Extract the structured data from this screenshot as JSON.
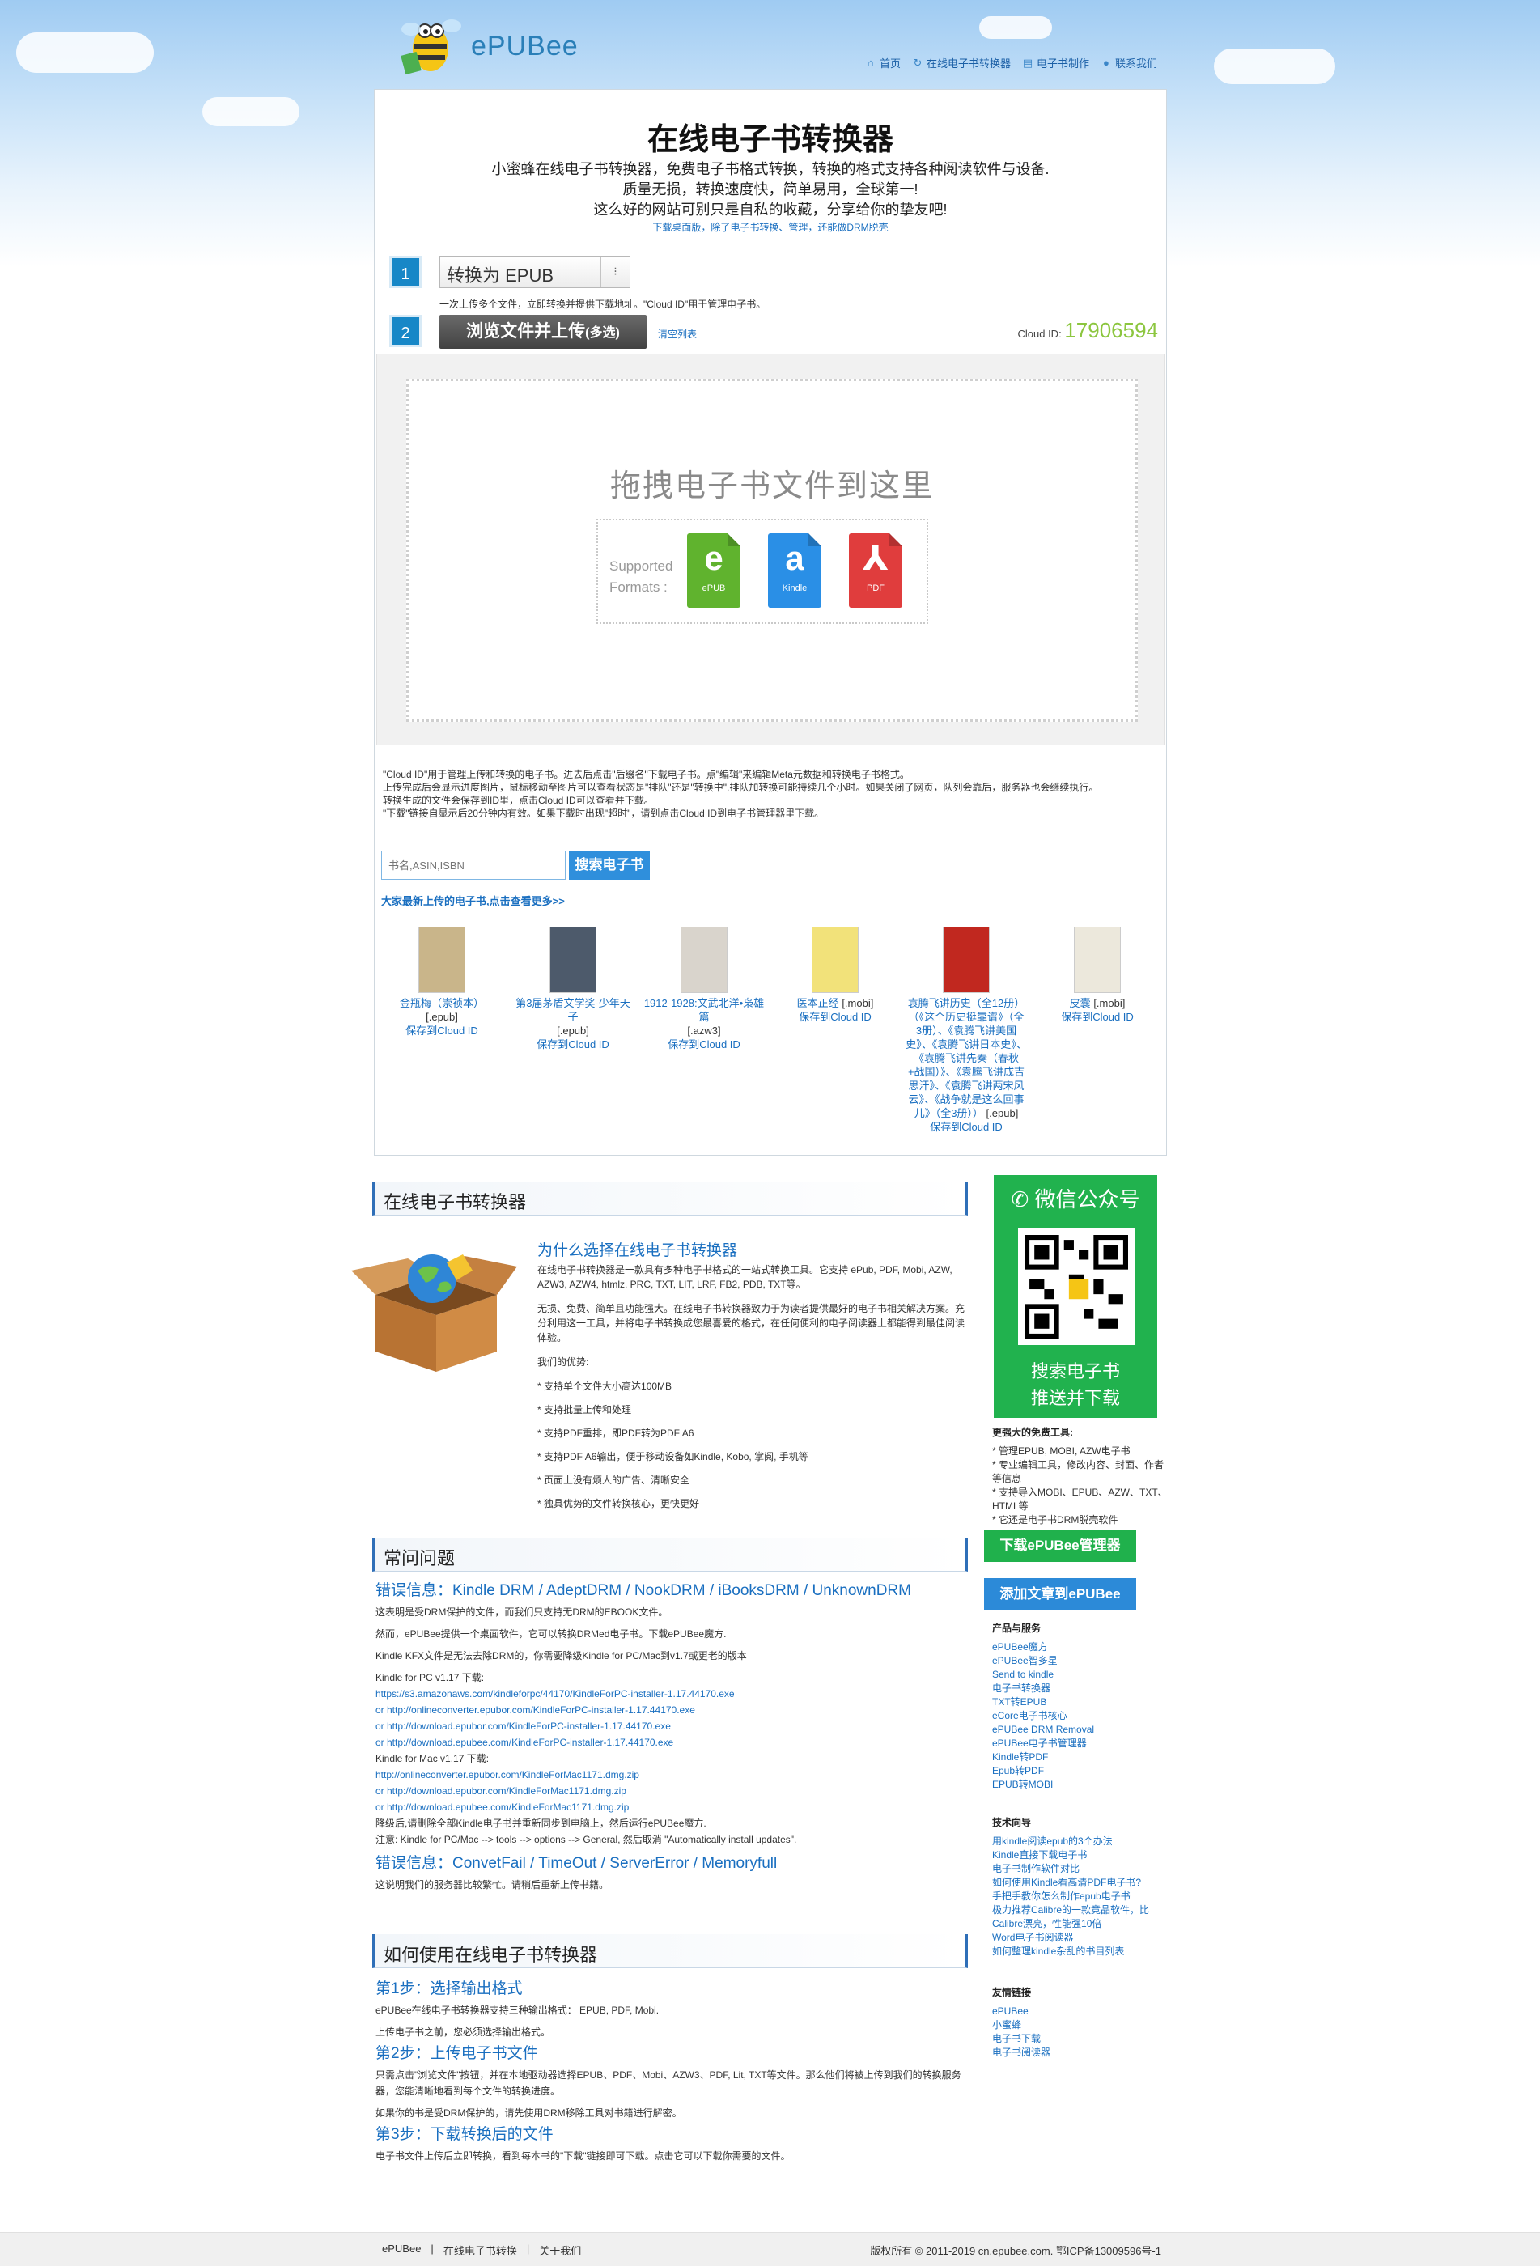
{
  "header": {
    "logo_text": "ePUBee",
    "nav": [
      {
        "icon": "home-icon",
        "label": "首页"
      },
      {
        "icon": "refresh-icon",
        "label": "在线电子书转换器"
      },
      {
        "icon": "book-icon",
        "label": "电子书制作"
      },
      {
        "icon": "user-icon",
        "label": "联系我们"
      }
    ]
  },
  "converter": {
    "title": "在线电子书转换器",
    "intro_lines": [
      "小蜜蜂在线电子书转换器，免费电子书格式转换，转换的格式支持各种阅读软件与设备.",
      "质量无损，转换速度快，简单易用，全球第一!",
      "这么好的网站可别只是自私的收藏，分享给你的挚友吧!"
    ],
    "desktop_link": "下载桌面版，除了电子书转换、管理，还能做DRM脱壳",
    "step1_number": "1",
    "step1_select": "转换为 EPUB",
    "step1_select_arrow": "⁝",
    "step1_note": "一次上传多个文件，立即转换并提供下载地址。\"Cloud ID\"用于管理电子书。",
    "step2_number": "2",
    "upload_button": "浏览文件并上传",
    "upload_button_suffix": "(多选)",
    "clear_list": "清空列表",
    "cloud_id_label": "Cloud ID:",
    "cloud_id_value": "17906594",
    "drop_text": "拖拽电子书文件到这里",
    "supported_label": [
      "Supported",
      "Formats :"
    ],
    "formats": [
      {
        "glyph": "e",
        "caption": "ePUB",
        "icon": "epub-icon"
      },
      {
        "glyph": "a",
        "caption": "Kindle",
        "icon": "kindle-icon"
      },
      {
        "glyph": "⅄",
        "caption": "PDF",
        "icon": "pdf-icon"
      }
    ],
    "notes": [
      "\"Cloud ID\"用于管理上传和转换的电子书。进去后点击\"后缀名\"下载电子书。点\"编辑\"来编辑Meta元数据和转换电子书格式。",
      "上传完成后会显示进度图片，鼠标移动至图片可以查看状态是\"排队\"还是\"转换中\",排队加转换可能持续几个小时。如果关闭了网页，队列会靠后，服务器也会继续执行。",
      "转换生成的文件会保存到ID里，点击Cloud ID可以查看并下载。",
      "\"下载\"链接自显示后20分钟内有效。如果下载时出现\"超时\"，请到点击Cloud ID到电子书管理器里下载。"
    ],
    "search_placeholder": "书名,ASIN,ISBN",
    "search_button": "搜索电子书",
    "latest_link": "大家最新上传的电子书,点击查看更多>>",
    "books": [
      {
        "title": "金瓶梅（崇祯本）",
        "ext": "[.epub]",
        "save": "保存到Cloud ID",
        "cover": "#c9b58a"
      },
      {
        "title": "第3届茅盾文学奖-少年天子",
        "ext": "[.epub]",
        "save": "保存到Cloud ID",
        "cover": "#4d5a6b"
      },
      {
        "title": "1912-1928:文武北洋•枭雄篇",
        "ext": "[.azw3]",
        "save": "保存到Cloud ID",
        "cover": "#d9d4cc"
      },
      {
        "title": "医本正经",
        "ext": "[.mobi]",
        "save": "保存到Cloud ID",
        "cover": "#f2e27a"
      },
      {
        "title": "袁腾飞讲历史（全12册）（《这个历史挺靠谱》（全3册）、《袁腾飞讲美国史》、《袁腾飞讲日本史》、《袁腾飞讲先秦（春秋+战国）》、《袁腾飞讲成吉思汗》、《袁腾飞讲两宋风云》、《战争就是这么回事儿》（全3册））",
        "ext": "[.epub]",
        "save": "保存到Cloud ID",
        "cover": "#c1281f"
      },
      {
        "title": "皮囊",
        "ext": "[.mobi]",
        "save": "保存到Cloud ID",
        "cover": "#ece8dc"
      }
    ]
  },
  "about": {
    "section_title": "在线电子书转换器",
    "why_title": "为什么选择在线电子书转换器",
    "paragraphs": [
      "在线电子书转换器是一款具有多种电子书格式的一站式转换工具。它支持 ePub, PDF, Mobi, AZW, AZW3, AZW4, htmlz, PRC, TXT, LIT, LRF, FB2, PDB, TXT等。",
      "无损、免费、简单且功能强大。在线电子书转换器致力于为读者提供最好的电子书相关解决方案。充分利用这一工具，并将电子书转换成您最喜爱的格式，在任何便利的电子阅读器上都能得到最佳阅读体验。",
      "我们的优势:"
    ],
    "advantages": [
      "支持单个文件大小高达100MB",
      "支持批量上传和处理",
      "支持PDF重排，即PDF转为PDF A6",
      "支持PDF A6输出，便于移动设备如Kindle, Kobo, 掌阅, 手机等",
      "页面上没有烦人的广告、清晰安全",
      "独具优势的文件转换核心，更快更好"
    ]
  },
  "faq": {
    "section_title": "常问问题",
    "drm_title": "错误信息：Kindle DRM / AdeptDRM / NookDRM / iBooksDRM / UnknownDRM",
    "drm_lines": [
      "这表明是受DRM保护的文件，而我们只支持无DRM的EBOOK文件。",
      "然而，ePUBee提供一个桌面软件，它可以转换DRMed电子书。下载ePUBee魔方.",
      "Kindle KFX文件是无法去除DRM的，你需要降级Kindle for PC/Mac到v1.7或更老的版本"
    ],
    "pc_label": "Kindle for PC v1.17 下载:",
    "pc_urls": [
      "https://s3.amazonaws.com/kindleforpc/44170/KindleForPC-installer-1.17.44170.exe",
      "or http://onlineconverter.epubor.com/KindleForPC-installer-1.17.44170.exe",
      "or http://download.epubor.com/KindleForPC-installer-1.17.44170.exe",
      "or http://download.epubee.com/KindleForPC-installer-1.17.44170.exe"
    ],
    "mac_label": "Kindle for Mac v1.17 下载:",
    "mac_urls": [
      "http://onlineconverter.epubor.com/KindleForMac1171.dmg.zip",
      "or http://download.epubor.com/KindleForMac1171.dmg.zip",
      "or http://download.epubee.com/KindleForMac1171.dmg.zip"
    ],
    "downgrade_note": "降级后,请删除全部Kindle电子书并重新同步到电脑上，然后运行ePUBee魔方.",
    "setting_note": "注意: Kindle for PC/Mac --> tools --> options --> General, 然后取消 \"Automatically install updates\".",
    "fail_title": "错误信息：ConvetFail / TimeOut / ServerError / Memoryfull",
    "fail_line": "这说明我们的服务器比较繁忙。请稍后重新上传书籍。"
  },
  "howto": {
    "section_title": "如何使用在线电子书转换器",
    "step1_title": "第1步：选择输出格式",
    "step1_lines": [
      "ePUBee在线电子书转换器支持三种输出格式： EPUB, PDF, Mobi.",
      "上传电子书之前，您必须选择输出格式。"
    ],
    "step2_title": "第2步：上传电子书文件",
    "step2_lines": [
      "只需点击\"浏览文件\"按钮，并在本地驱动器选择EPUB、PDF、Mobi、AZW3、PDF, Lit, TXT等文件。那么他们将被上传到我们的转换服务器，您能清晰地看到每个文件的转换进度。",
      "如果你的书是受DRM保护的，请先使用DRM移除工具对书籍进行解密。"
    ],
    "step3_title": "第3步：下载转换后的文件",
    "step3_lines": [
      "电子书文件上传后立即转换，看到每本书的\"下载\"链接即可下载。点击它可以下载你需要的文件。"
    ]
  },
  "sidebar": {
    "wechat_title": "微信公众号",
    "wechat_tagline": [
      "搜索电子书",
      "推送并下载"
    ],
    "tools_title": "更强大的免费工具:",
    "tools": [
      "* 管理EPUB, MOBI, AZW电子书",
      "* 专业编辑工具，修改内容、封面、作者等信息",
      "* 支持导入MOBI、EPUB、AZW、TXT、HTML等",
      "* 它还是电子书DRM脱壳软件"
    ],
    "download_button": "下载ePUBee管理器",
    "add_article_button": "添加文章到ePUBee",
    "products_title": "产品与服务",
    "products": [
      "ePUBee魔方",
      "ePUBee智多星",
      "Send to kindle",
      "电子书转换器",
      "TXT转EPUB",
      "eCore电子书核心",
      "ePUBee DRM Removal",
      "ePUBee电子书管理器",
      "Kindle转PDF",
      "Epub转PDF",
      "EPUB转MOBI"
    ],
    "tech_title": "技术向导",
    "tech": [
      "用kindle阅读epub的3个办法",
      "Kindle直接下载电子书",
      "电子书制作软件对比",
      "如何使用Kindle看高清PDF电子书?",
      "手把手教你怎么制作epub电子书",
      "极力推荐Calibre的一款竞品软件，比Calibre漂亮，性能强10倍",
      "Word电子书阅读器",
      "如何整理kindle杂乱的书目列表"
    ],
    "friends_title": "友情链接",
    "friends": [
      "ePUBee",
      "小蜜蜂",
      "电子书下载",
      "电子书阅读器"
    ]
  },
  "footer": {
    "links": [
      "ePUBee",
      "|",
      "在线电子书转换",
      "|",
      "关于我们"
    ],
    "copyright": "版权所有 © 2011-2019 cn.epubee.com. 鄂ICP备13009596号-1"
  }
}
